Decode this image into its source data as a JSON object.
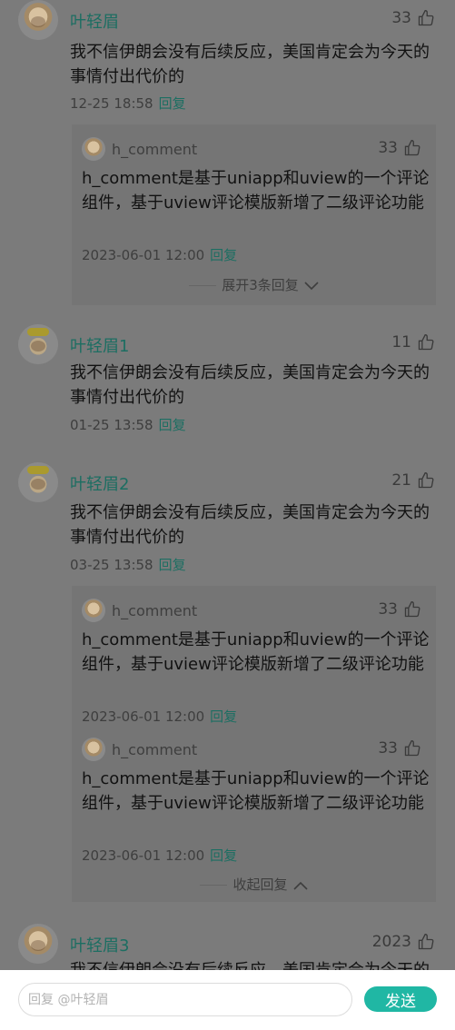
{
  "comments": [
    {
      "name": "叶轻眉",
      "likes": "33",
      "text": "我不信伊朗会没有后续反应，美国肯定会为今天的事情付出代价的",
      "time": "12-25 18:58",
      "reply_label": "回复",
      "replies": [
        {
          "name": "h_comment",
          "likes": "33",
          "text": "h_comment是基于uniapp和uview的一个评论组件，基于uview评论模版新增了二级评论功能",
          "time": "2023-06-01 12:00",
          "reply_label": "回复"
        }
      ],
      "toggle_label": "展开3条回复"
    },
    {
      "name": "叶轻眉1",
      "likes": "11",
      "text": "我不信伊朗会没有后续反应，美国肯定会为今天的事情付出代价的",
      "time": "01-25 13:58",
      "reply_label": "回复"
    },
    {
      "name": "叶轻眉2",
      "likes": "21",
      "text": "我不信伊朗会没有后续反应，美国肯定会为今天的事情付出代价的",
      "time": "03-25 13:58",
      "reply_label": "回复",
      "replies": [
        {
          "name": "h_comment",
          "likes": "33",
          "text": "h_comment是基于uniapp和uview的一个评论组件，基于uview评论模版新增了二级评论功能",
          "time": "2023-06-01 12:00",
          "reply_label": "回复"
        },
        {
          "name": "h_comment",
          "likes": "33",
          "text": "h_comment是基于uniapp和uview的一个评论组件，基于uview评论模版新增了二级评论功能",
          "time": "2023-06-01 12:00",
          "reply_label": "回复"
        }
      ],
      "toggle_label": "收起回复"
    },
    {
      "name": "叶轻眉3",
      "likes": "2023",
      "text": "我不信伊朗会没有后续反应，美国肯定会为今天的事情付出代价的"
    }
  ],
  "input": {
    "placeholder": "回复 @叶轻眉"
  },
  "send_label": "发送",
  "icons": {
    "like": "thumbs-up-icon",
    "expand": "chevron-down-icon",
    "collapse": "chevron-up-icon"
  },
  "colors": {
    "accent": "#20b7a4",
    "name": "#1c6e62"
  }
}
